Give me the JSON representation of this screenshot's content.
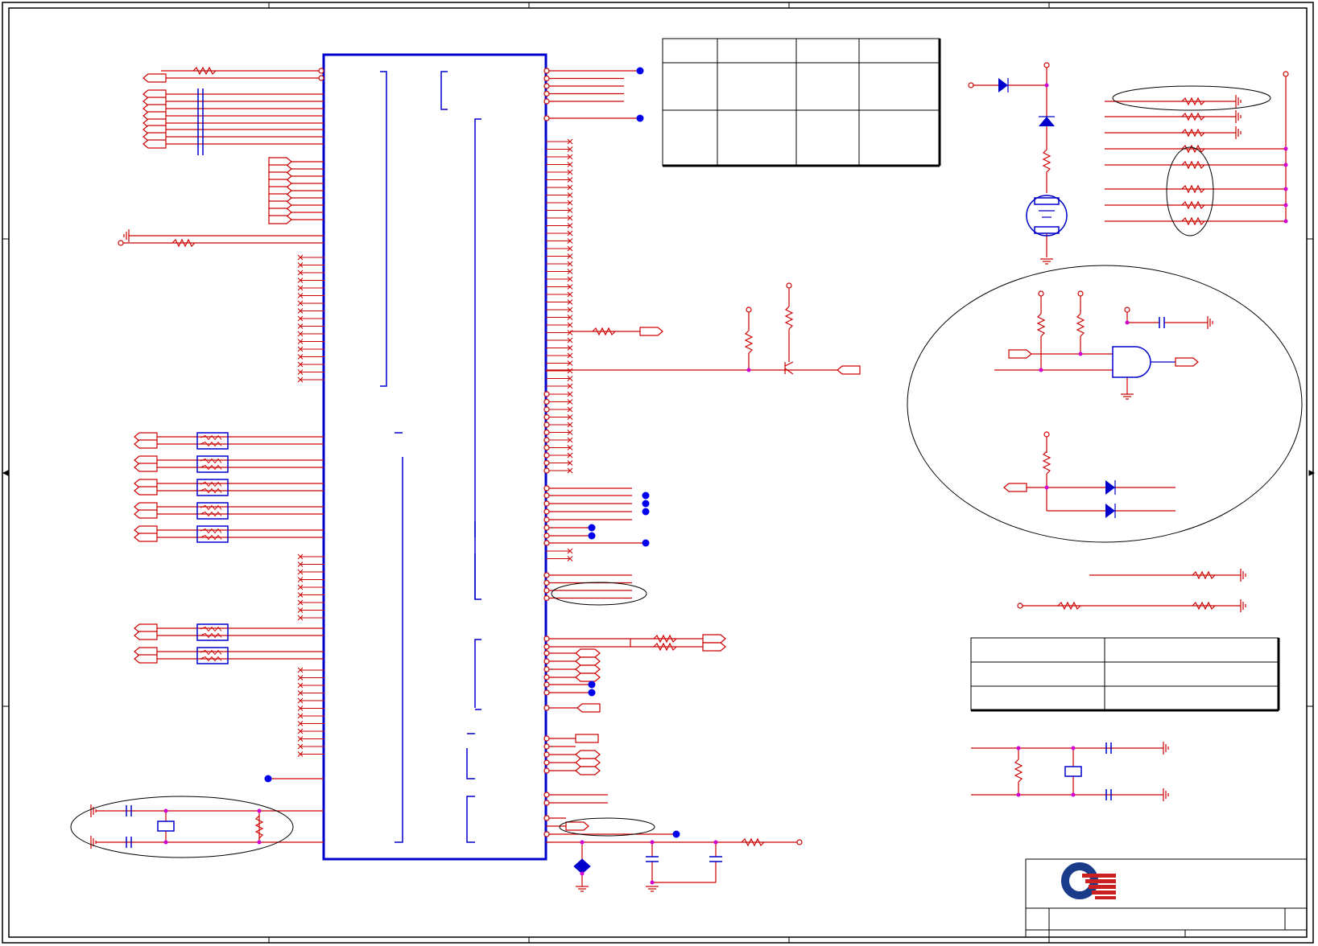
{
  "page": {
    "background": "#ffffff"
  },
  "colors": {
    "border": "#000000",
    "wire_red": "#cc0000",
    "wire_blue": "#0000cc",
    "junction_magenta": "#d000d0",
    "junction_dot": "#0000ee",
    "logo_blue": "#1a3a8a",
    "logo_red": "#cc1f1f"
  },
  "symbols": {
    "ic": "ic-package-u1",
    "resistor": "resistor-icon",
    "capacitor": "capacitor-icon",
    "ground": "ground-icon",
    "diode": "diode-icon",
    "crystal": "crystal-icon",
    "battery": "coin-battery-icon",
    "and_gate": "and-gate-icon",
    "transistor": "npn-transistor-icon",
    "connector": "net-connector-icon",
    "logo": "quanta-logo"
  },
  "tables": {
    "strap_table": {
      "rows": 3,
      "cols": 4
    },
    "title_block": {
      "rows": 3,
      "cols": 2
    }
  },
  "title_block": {
    "logo": "quanta-logo"
  }
}
